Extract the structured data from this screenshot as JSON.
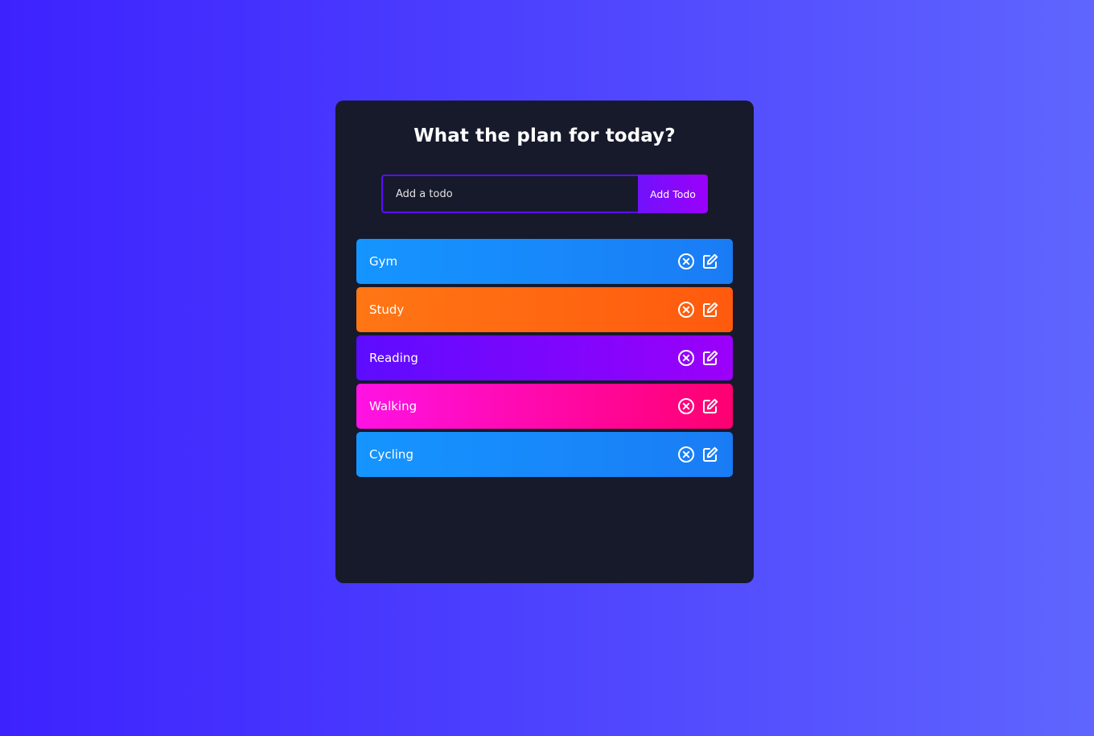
{
  "header": {
    "title": "What the plan for today?"
  },
  "form": {
    "placeholder": "Add a todo",
    "value": "",
    "button_label": "Add Todo"
  },
  "todos": [
    {
      "text": "Gym",
      "color": "blue",
      "remove_icon": "close-circle-icon",
      "edit_icon": "edit-icon"
    },
    {
      "text": "Study",
      "color": "orange",
      "remove_icon": "close-circle-icon",
      "edit_icon": "edit-icon"
    },
    {
      "text": "Reading",
      "color": "purple",
      "remove_icon": "close-circle-icon",
      "edit_icon": "edit-icon"
    },
    {
      "text": "Walking",
      "color": "pink",
      "remove_icon": "close-circle-icon",
      "edit_icon": "edit-icon"
    },
    {
      "text": "Cycling",
      "color": "blue",
      "remove_icon": "close-circle-icon",
      "edit_icon": "edit-icon"
    }
  ],
  "colors": {
    "background_start": "#3d22fe",
    "background_end": "#5f65fe",
    "card": "#161a2b",
    "accent": "#5d0cff",
    "blue": "#1595ff",
    "orange": "#ff7614",
    "purple": "#7112fc",
    "pink": "#ff12e4"
  }
}
